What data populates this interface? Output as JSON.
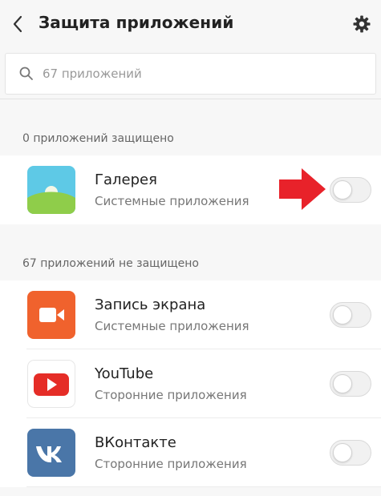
{
  "header": {
    "title": "Защита приложений",
    "back_icon": "chevron-left-icon",
    "settings_icon": "gear-icon"
  },
  "search": {
    "placeholder": "67 приложений",
    "icon": "search-icon"
  },
  "sections": [
    {
      "label": "0 приложений защищено",
      "apps": [
        {
          "name": "Галерея",
          "category": "Системные приложения",
          "icon": "gallery-icon",
          "protected": false
        }
      ]
    },
    {
      "label": "67 приложений не защищено",
      "apps": [
        {
          "name": "Запись экрана",
          "category": "Системные приложения",
          "icon": "screen-recorder-icon",
          "protected": false
        },
        {
          "name": "YouTube",
          "category": "Сторонние приложения",
          "icon": "youtube-icon",
          "protected": false
        },
        {
          "name": "ВКонтакте",
          "category": "Сторонние приложения",
          "icon": "vk-icon",
          "protected": false
        }
      ]
    }
  ],
  "annotation": {
    "icon": "red-arrow-icon",
    "color": "#e8222a"
  },
  "colors": {
    "background": "#f7f7f7",
    "card": "#ffffff",
    "gallery_top": "#5ec9e6",
    "gallery_bottom": "#8fcd4a",
    "screen_recorder": "#f0622d",
    "youtube": "#e52d27",
    "vk": "#4a76a8"
  }
}
